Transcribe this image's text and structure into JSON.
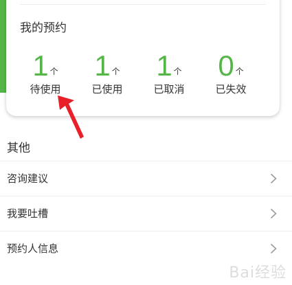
{
  "reservations": {
    "title": "我的预约",
    "stats": [
      {
        "value": "1",
        "unit": "个",
        "label": "待使用"
      },
      {
        "value": "1",
        "unit": "个",
        "label": "已使用"
      },
      {
        "value": "1",
        "unit": "个",
        "label": "已取消"
      },
      {
        "value": "0",
        "unit": "个",
        "label": "已失效"
      }
    ]
  },
  "other": {
    "title": "其他",
    "items": [
      {
        "label": "咨询建议"
      },
      {
        "label": "我要吐槽"
      },
      {
        "label": "预约人信息"
      }
    ]
  },
  "colors": {
    "accent": "#55b648",
    "arrow": "#e8202a"
  },
  "watermark": "Bai经验"
}
